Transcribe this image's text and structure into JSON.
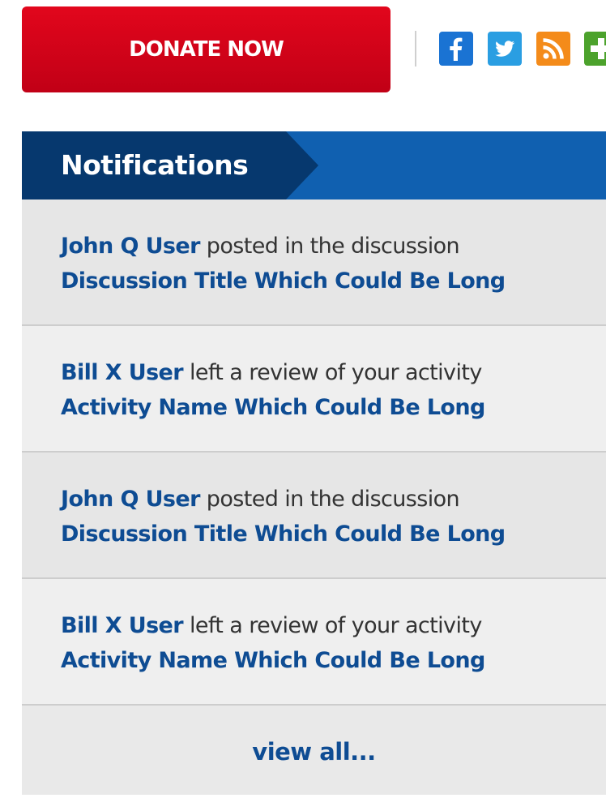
{
  "topbar": {
    "donate_label": "DONATE NOW",
    "social": [
      {
        "icon": "facebook-icon",
        "glyph": "f",
        "color": "#1a73d3"
      },
      {
        "icon": "twitter-icon",
        "glyph": "bird",
        "color": "#2a9ee2"
      },
      {
        "icon": "rss-icon",
        "glyph": "rss",
        "color": "#f48b1a"
      },
      {
        "icon": "plus-icon",
        "glyph": "+",
        "color": "#4ca22c"
      }
    ]
  },
  "notifications": {
    "title": "Notifications",
    "items": [
      {
        "user": "John Q User",
        "action": " posted in the discussion",
        "target": "Discussion Title Which Could Be Long"
      },
      {
        "user": "Bill X User",
        "action": " left a review of your activity",
        "target": "Activity Name Which Could Be Long"
      },
      {
        "user": "John Q User",
        "action": " posted in the discussion",
        "target": "Discussion Title Which Could Be Long"
      },
      {
        "user": "Bill X User",
        "action": " left a review of your activity",
        "target": "Activity Name Which Could Be Long"
      }
    ],
    "view_all_label": "view all..."
  },
  "colors": {
    "donate": "#d4001a",
    "header_dark": "#06386e",
    "header_light": "#1060b0",
    "link": "#0e4c93"
  }
}
